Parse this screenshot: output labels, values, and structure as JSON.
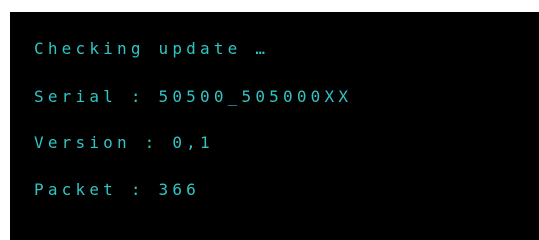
{
  "console": {
    "text_color": "#33c3c3",
    "background_color": "#000000",
    "lines": [
      "Checking update …",
      "Serial : 50500_505000XX",
      "Version : 0,1",
      "Packet : 366"
    ]
  }
}
